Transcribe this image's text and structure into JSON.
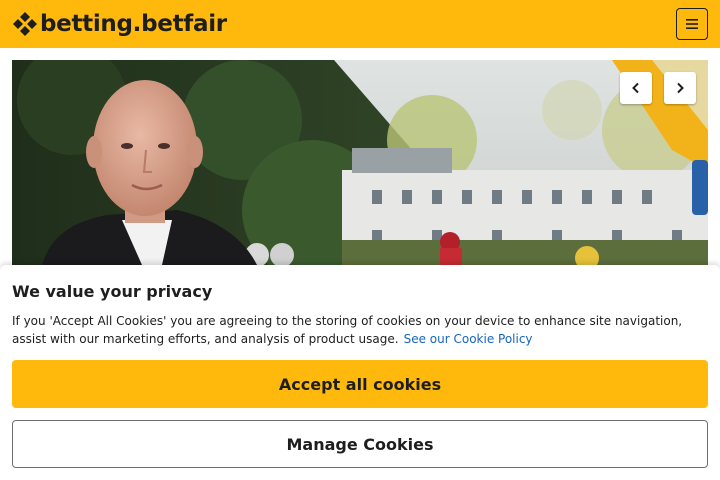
{
  "header": {
    "logo_text": "betting.betfair",
    "menu_icon": "hamburger-menu-icon",
    "brand_color": "#ffb80c"
  },
  "hero": {
    "prev_icon": "chevron-left-icon",
    "next_icon": "chevron-right-icon"
  },
  "cookie_banner": {
    "title": "We value your privacy",
    "body": "If you 'Accept All Cookies' you are agreeing to the storing of cookies on your device to enhance site navigation, assist with our marketing efforts, and analysis of product usage.",
    "policy_link": "See our Cookie Policy",
    "accept_label": "Accept all cookies",
    "manage_label": "Manage Cookies",
    "link_color": "#1565c0"
  }
}
